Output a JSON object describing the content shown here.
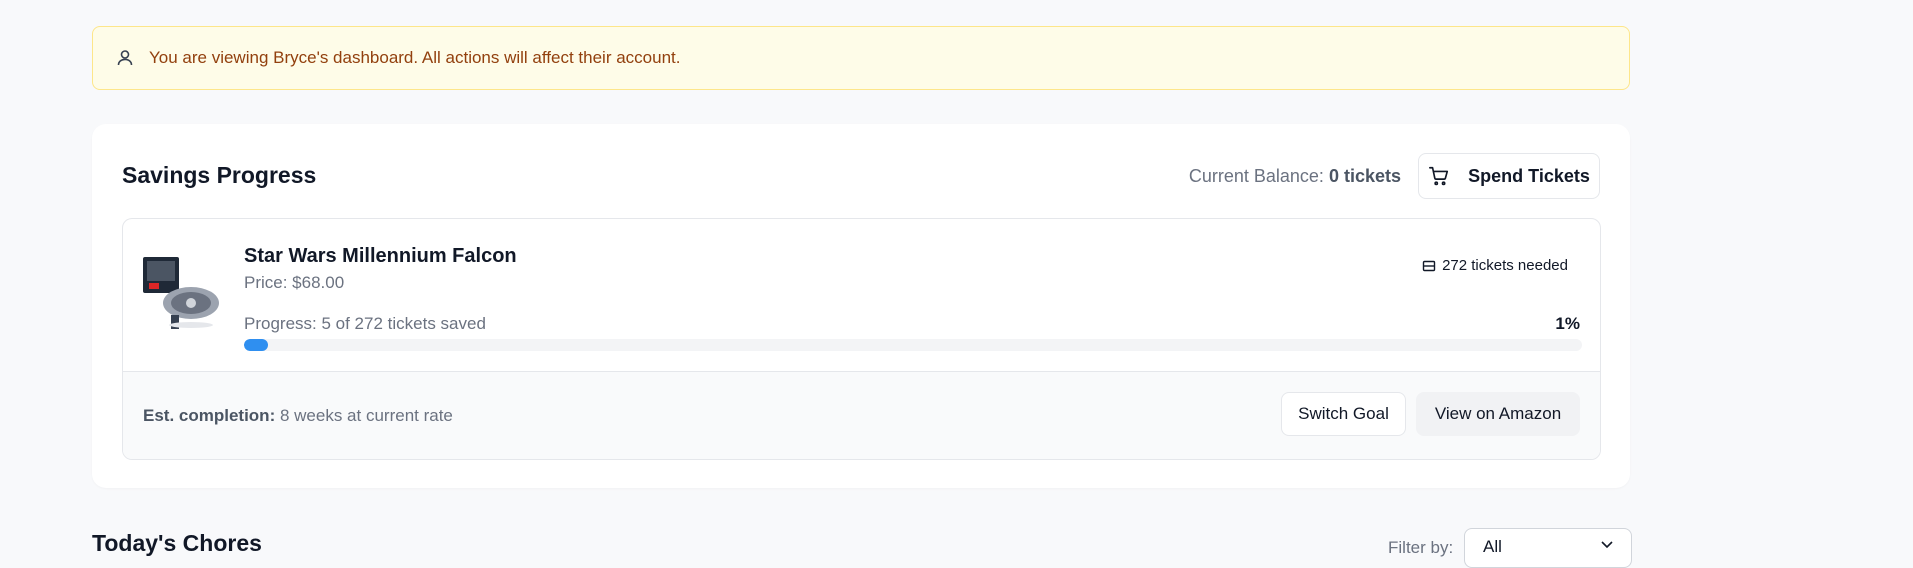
{
  "banner": {
    "icon": "user-icon",
    "message": "You are viewing Bryce's dashboard. All actions will affect their account."
  },
  "savings": {
    "title": "Savings Progress",
    "balance_label": "Current Balance:",
    "balance_value": "0 tickets",
    "spend_button": {
      "label": "Spend Tickets",
      "icon": "cart-icon"
    },
    "goal": {
      "name": "Star Wars Millennium Falcon",
      "price": "Price: $68.00",
      "tickets_needed": "272 tickets needed",
      "tickets_icon": "ticket-icon",
      "image_icon": "lego-falcon-image",
      "progress_label": "Progress: 5 of 272 tickets saved",
      "percent_label": "1%",
      "progress_fraction": 0.018,
      "est_label": "Est. completion:",
      "est_value": "8 weeks at current rate",
      "switch_button": "Switch Goal",
      "amazon_button": "View on Amazon"
    }
  },
  "chores": {
    "title": "Today's Chores",
    "filter_label": "Filter by:",
    "filter_value": "All"
  },
  "colors": {
    "accent": "#2f8ff0",
    "banner_bg": "#fefce8",
    "banner_text": "#92400e"
  }
}
